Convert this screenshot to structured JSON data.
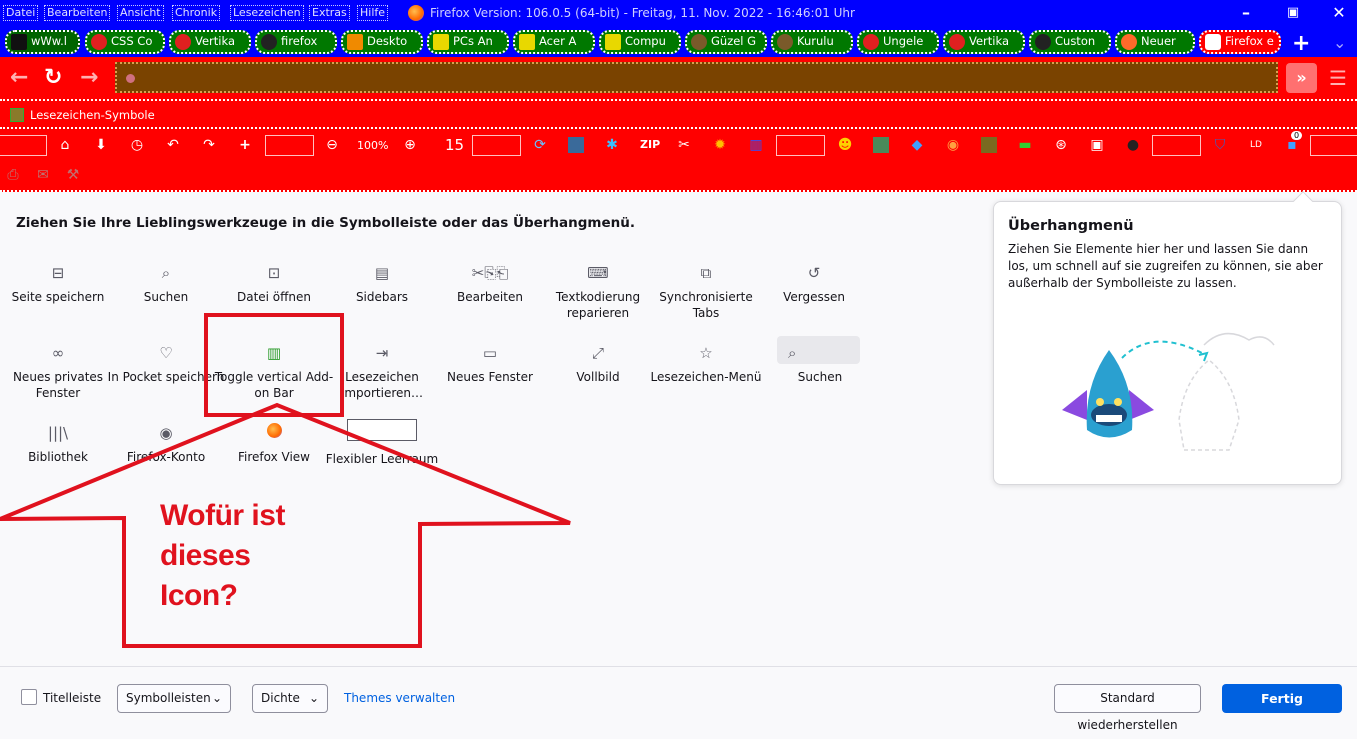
{
  "menubar": {
    "items": [
      "Datei",
      "Bearbeiten",
      "Ansicht",
      "Chronik",
      "Lesezeichen",
      "Extras",
      "Hilfe"
    ],
    "title": "Firefox Version: 106.0.5 (64-bit)  -  Freitag, 11. Nov. 2022 - 16:46:01 Uhr"
  },
  "tabs": [
    {
      "label": "wWw.l",
      "color": "#111111"
    },
    {
      "label": "CSS Co",
      "color": "#e02020"
    },
    {
      "label": "Vertika",
      "color": "#e02020"
    },
    {
      "label": "firefox",
      "color": "#222222"
    },
    {
      "label": "Deskto",
      "color": "#f08a00"
    },
    {
      "label": "PCs An",
      "color": "#e8d800"
    },
    {
      "label": "Acer A",
      "color": "#e8d800"
    },
    {
      "label": "Compu",
      "color": "#e8d800"
    },
    {
      "label": "Güzel G",
      "color": "#7a5a2a"
    },
    {
      "label": "Kurulu",
      "color": "#7a5a2a"
    },
    {
      "label": "Ungele",
      "color": "#e02020"
    },
    {
      "label": "Vertika",
      "color": "#e02020"
    },
    {
      "label": "Custon",
      "color": "#222222"
    },
    {
      "label": "Neuer",
      "color": "#ff6a2a"
    },
    {
      "label": "Firefox e",
      "color": "#ffffff"
    }
  ],
  "bookmarks": {
    "label": "Lesezeichen-Symbole"
  },
  "toolbar": {
    "zoom": "100%",
    "fifteen": "15",
    "badge": "0"
  },
  "customize": {
    "instructions": "Ziehen Sie Ihre Lieblingswerkzeuge in die Symbolleiste oder das Überhangmenü.",
    "items": [
      {
        "label": "Seite speichern",
        "icon": "save-page-icon"
      },
      {
        "label": "Suchen",
        "icon": "search-icon"
      },
      {
        "label": "Datei öffnen",
        "icon": "open-file-icon"
      },
      {
        "label": "Sidebars",
        "icon": "sidebars-icon"
      },
      {
        "label": "Bearbeiten",
        "icon": "edit-icon"
      },
      {
        "label": "Textkodierung reparieren",
        "icon": "text-encoding-icon"
      },
      {
        "label": "Synchronisierte Tabs",
        "icon": "synced-tabs-icon"
      },
      {
        "label": "Vergessen",
        "icon": "forget-icon"
      },
      {
        "label": "Neues privates Fenster",
        "icon": "private-window-icon"
      },
      {
        "label": "In Pocket speichern",
        "icon": "pocket-icon"
      },
      {
        "label": "Toggle vertical Add-on Bar",
        "icon": "addon-bar-icon"
      },
      {
        "label": "Lesezeichen importieren…",
        "icon": "import-bookmarks-icon"
      },
      {
        "label": "Neues Fenster",
        "icon": "new-window-icon"
      },
      {
        "label": "Vollbild",
        "icon": "fullscreen-icon"
      },
      {
        "label": "Lesezeichen-Menü",
        "icon": "bookmarks-menu-icon"
      },
      {
        "label": "Suchen",
        "icon": "search-icon"
      },
      {
        "label": "Bibliothek",
        "icon": "library-icon"
      },
      {
        "label": "Firefox-Konto",
        "icon": "account-icon"
      },
      {
        "label": "Firefox View",
        "icon": "firefox-view-icon"
      },
      {
        "label": "Flexibler Leerraum",
        "icon": "flexible-space-icon"
      }
    ]
  },
  "overflow": {
    "title": "Überhangmenü",
    "text": "Ziehen Sie Elemente hier her und lassen Sie dann los, um schnell auf sie zugreifen zu können, sie aber außerhalb der Symbolleiste zu lassen."
  },
  "annotation": {
    "line1": "Wofür ist",
    "line2": "dieses",
    "line3": "Icon?",
    "color": "#e0121e"
  },
  "footer": {
    "titlebar_label": "Titelleiste",
    "toolbars_label": "Symbolleisten",
    "density_label": "Dichte",
    "themes_link": "Themes verwalten",
    "restore_label": "Standard wiederherstellen",
    "done_label": "Fertig"
  },
  "colors": {
    "accent": "#0061e0",
    "titlebar": "#0000ff",
    "toolbar": "#ff0000"
  }
}
